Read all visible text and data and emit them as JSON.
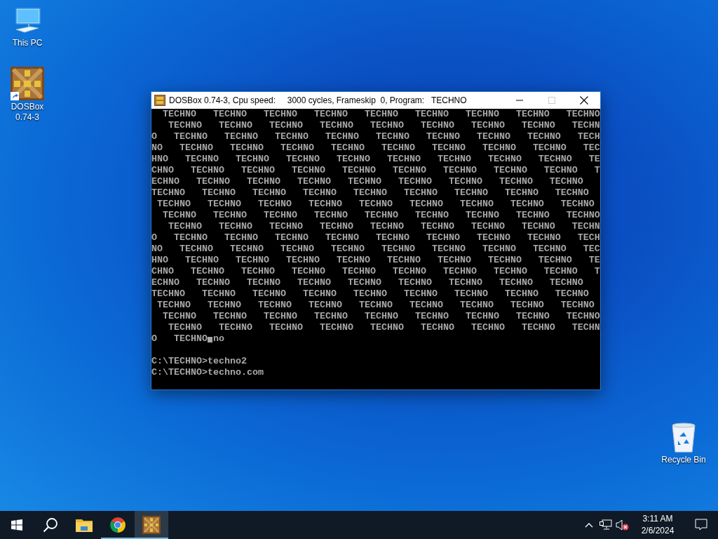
{
  "desktop_icons": [
    {
      "label": "This PC",
      "kind": "computer"
    },
    {
      "label": "DOSBox 0.74-3",
      "kind": "dosbox",
      "shortcut": true
    }
  ],
  "recycle_bin": {
    "label": "Recycle Bin"
  },
  "dosbox_window": {
    "title": "DOSBox 0.74-3, Cpu speed:     3000 cycles, Frameskip  0, Program:   TECHNO",
    "maximize_disabled": true,
    "console_lines": [
      {
        "kind": "text",
        "text": "  TECHNO   TECHNO   TECHNO   TECHNO   TECHNO   TECHNO   TECHNO   TECHNO   TECHNO"
      },
      {
        "kind": "text",
        "text": "   TECHNO   TECHNO   TECHNO   TECHNO   TECHNO   TECHNO   TECHNO   TECHNO   TECHN"
      },
      {
        "kind": "text",
        "text": "O   TECHNO   TECHNO   TECHNO   TECHNO   TECHNO   TECHNO   TECHNO   TECHNO   TECH"
      },
      {
        "kind": "text",
        "text": "NO   TECHNO   TECHNO   TECHNO   TECHNO   TECHNO   TECHNO   TECHNO   TECHNO   TEC"
      },
      {
        "kind": "text",
        "text": "HNO   TECHNO   TECHNO   TECHNO   TECHNO   TECHNO   TECHNO   TECHNO   TECHNO   TE"
      },
      {
        "kind": "text",
        "text": "CHNO   TECHNO   TECHNO   TECHNO   TECHNO   TECHNO   TECHNO   TECHNO   TECHNO   T"
      },
      {
        "kind": "text",
        "text": "ECHNO   TECHNO   TECHNO   TECHNO   TECHNO   TECHNO   TECHNO   TECHNO   TECHNO"
      },
      {
        "kind": "text",
        "text": "TECHNO   TECHNO   TECHNO   TECHNO   TECHNO   TECHNO   TECHNO   TECHNO   TECHNO"
      },
      {
        "kind": "text",
        "text": " TECHNO   TECHNO   TECHNO   TECHNO   TECHNO   TECHNO   TECHNO   TECHNO   TECHNO"
      },
      {
        "kind": "text",
        "text": "  TECHNO   TECHNO   TECHNO   TECHNO   TECHNO   TECHNO   TECHNO   TECHNO   TECHNO"
      },
      {
        "kind": "text",
        "text": "   TECHNO   TECHNO   TECHNO   TECHNO   TECHNO   TECHNO   TECHNO   TECHNO   TECHN"
      },
      {
        "kind": "text",
        "text": "O   TECHNO   TECHNO   TECHNO   TECHNO   TECHNO   TECHNO   TECHNO   TECHNO   TECH"
      },
      {
        "kind": "text",
        "text": "NO   TECHNO   TECHNO   TECHNO   TECHNO   TECHNO   TECHNO   TECHNO   TECHNO   TEC"
      },
      {
        "kind": "text",
        "text": "HNO   TECHNO   TECHNO   TECHNO   TECHNO   TECHNO   TECHNO   TECHNO   TECHNO   TE"
      },
      {
        "kind": "text",
        "text": "CHNO   TECHNO   TECHNO   TECHNO   TECHNO   TECHNO   TECHNO   TECHNO   TECHNO   T"
      },
      {
        "kind": "text",
        "text": "ECHNO   TECHNO   TECHNO   TECHNO   TECHNO   TECHNO   TECHNO   TECHNO   TECHNO"
      },
      {
        "kind": "text",
        "text": "TECHNO   TECHNO   TECHNO   TECHNO   TECHNO   TECHNO   TECHNO   TECHNO   TECHNO"
      },
      {
        "kind": "text",
        "text": " TECHNO   TECHNO   TECHNO   TECHNO   TECHNO   TECHNO   TECHNO   TECHNO   TECHNO"
      },
      {
        "kind": "text",
        "text": "  TECHNO   TECHNO   TECHNO   TECHNO   TECHNO   TECHNO   TECHNO   TECHNO   TECHNO"
      },
      {
        "kind": "text",
        "text": "   TECHNO   TECHNO   TECHNO   TECHNO   TECHNO   TECHNO   TECHNO   TECHNO   TECHN"
      },
      {
        "kind": "cursor",
        "text": "O   TECHNO",
        "after": "no"
      },
      {
        "kind": "blank"
      },
      {
        "kind": "text",
        "text": "C:\\TECHNO>techno2"
      },
      {
        "kind": "text",
        "text": "C:\\TECHNO>techno.com"
      }
    ]
  },
  "taskbar": {
    "apps": [
      {
        "kind": "file-explorer",
        "running": false,
        "selected": false
      },
      {
        "kind": "browser",
        "running": true,
        "selected": false
      },
      {
        "kind": "dosbox",
        "running": true,
        "selected": true
      }
    ],
    "volume_muted": true,
    "clock": {
      "time": "3:11 AM",
      "date": "2/6/2024"
    }
  }
}
